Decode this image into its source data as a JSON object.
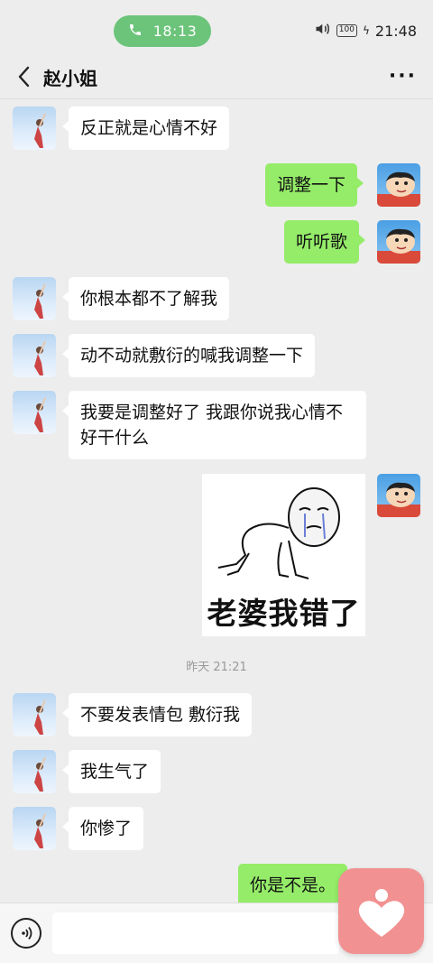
{
  "status_bar": {
    "call_time": "18:13",
    "battery": "100",
    "clock": "21:48",
    "icons": [
      "phone-icon",
      "speaker-icon",
      "battery-icon",
      "charging-icon"
    ]
  },
  "header": {
    "title": "赵小姐",
    "back_icon": "chevron-left-icon",
    "more_icon": "more-dots-icon"
  },
  "messages": [
    {
      "sender": "her",
      "text": "反正就是心情不好"
    },
    {
      "sender": "me",
      "text": "调整一下"
    },
    {
      "sender": "me",
      "text": "听听歌"
    },
    {
      "sender": "her",
      "text": "你根本都不了解我"
    },
    {
      "sender": "her",
      "text": "动不动就敷衍的喊我调整一下"
    },
    {
      "sender": "her",
      "text": "我要是调整好了 我跟你说我心情不好干什么"
    },
    {
      "sender": "me",
      "type": "sticker",
      "text": "老婆我错了"
    },
    {
      "sender": "her",
      "text": "不要发表情包 敷衍我"
    },
    {
      "sender": "her",
      "text": "我生气了"
    },
    {
      "sender": "her",
      "text": "你惨了"
    },
    {
      "sender": "me",
      "text": "你是不是。"
    }
  ],
  "timestamp": "昨天 21:21",
  "input_bar": {
    "voice_icon": "voice-icon",
    "input_value": ""
  },
  "colors": {
    "background": "#ededed",
    "my_bubble": "#95ec69",
    "their_bubble": "#ffffff",
    "call_pill": "#6cc47a",
    "floating_app": "#f19191"
  }
}
